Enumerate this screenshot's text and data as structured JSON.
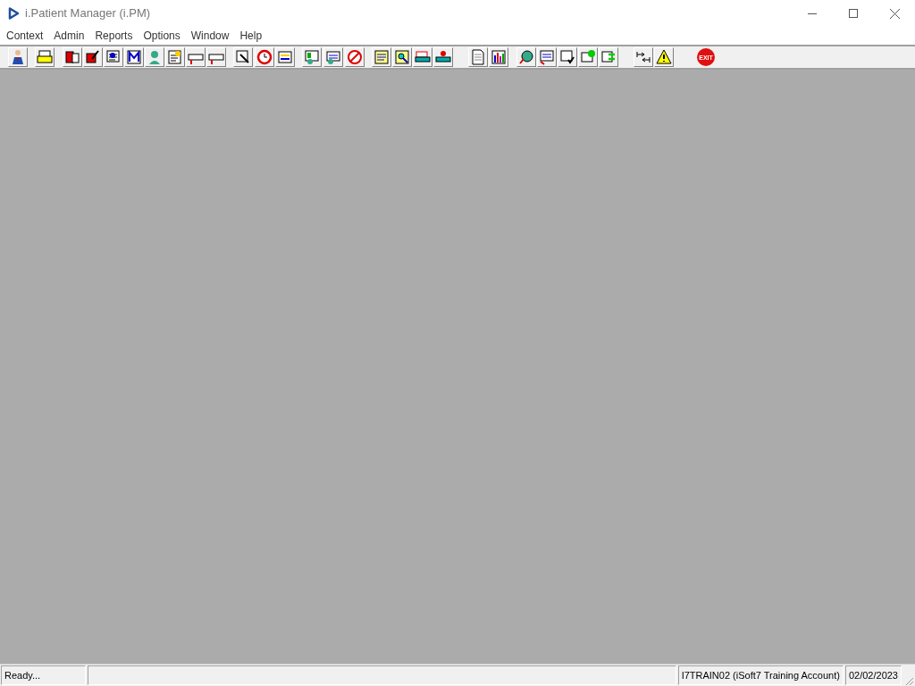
{
  "window": {
    "title": "i.Patient Manager (i.PM)"
  },
  "menu": [
    "Context",
    "Admin",
    "Reports",
    "Options",
    "Window",
    "Help"
  ],
  "toolbar": {
    "exit_label": "EXIT"
  },
  "status_bar": [
    "Ready...",
    "I7TRAIN02 (iSoft7 Training Account)",
    "02/02/2023"
  ]
}
